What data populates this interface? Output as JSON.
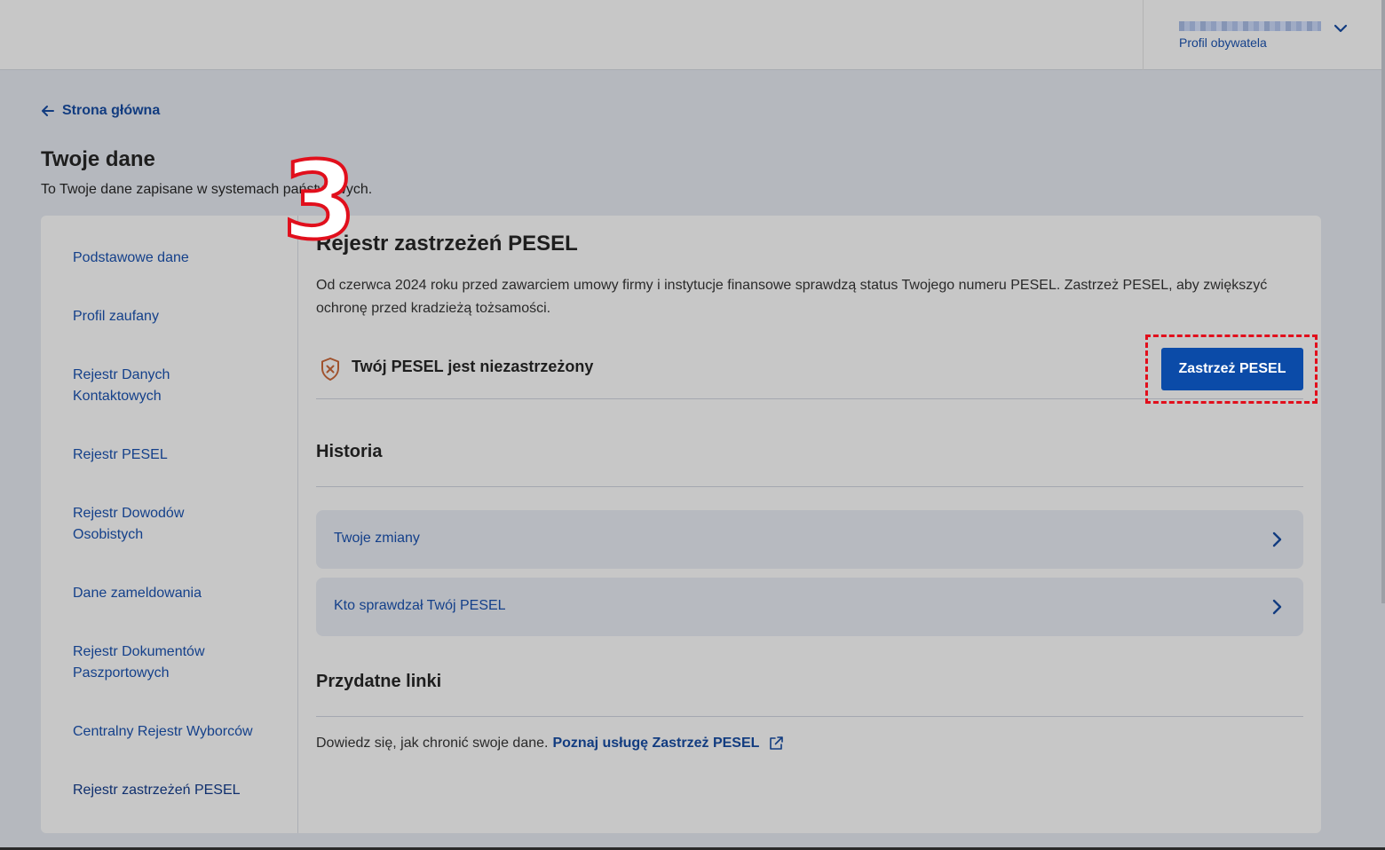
{
  "header": {
    "profile_label": "Profil obywatela"
  },
  "nav": {
    "back_label": "Strona główna"
  },
  "page": {
    "title": "Twoje dane",
    "subtitle": "To Twoje dane zapisane w systemach państwowych."
  },
  "sidebar": {
    "items": [
      {
        "label": "Podstawowe dane"
      },
      {
        "label": "Profil zaufany"
      },
      {
        "label": "Rejestr Danych Kontaktowych"
      },
      {
        "label": "Rejestr PESEL"
      },
      {
        "label": "Rejestr Dowodów Osobistych"
      },
      {
        "label": "Dane zameldowania"
      },
      {
        "label": "Rejestr Dokumentów Paszportowych"
      },
      {
        "label": "Centralny Rejestr Wyborców"
      },
      {
        "label": "Rejestr zastrzeżeń PESEL"
      }
    ]
  },
  "content": {
    "title": "Rejestr zastrzeżeń PESEL",
    "description": "Od czerwca 2024 roku przed zawarciem umowy firmy i instytucje finansowe sprawdzą status Twojego numeru PESEL. Zastrzeż PESEL, aby zwiększyć ochronę przed kradzieżą tożsamości.",
    "status_text": "Twój PESEL jest niezastrzeżony",
    "action_button": "Zastrzeż PESEL",
    "history_heading": "Historia",
    "history_items": [
      {
        "label": "Twoje zmiany"
      },
      {
        "label": "Kto sprawdzał Twój PESEL"
      }
    ],
    "links_heading": "Przydatne linki",
    "links_text": "Dowiedz się, jak chronić swoje dane.",
    "links_link": "Poznaj usługę Zastrzeż PESEL"
  },
  "annotation": {
    "step_number": "3",
    "highlight_color": "#e10f1c"
  },
  "colors": {
    "primary": "#0b4ba8",
    "link": "#14408a"
  }
}
